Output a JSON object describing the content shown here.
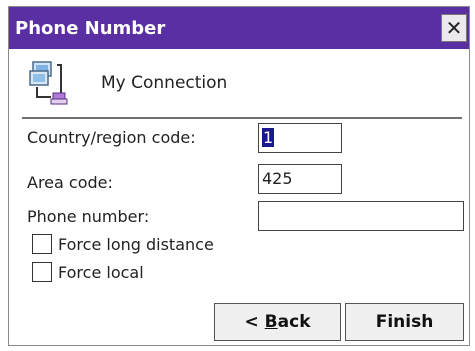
{
  "window": {
    "title": "Phone Number",
    "close_glyph": "✕"
  },
  "connection": {
    "icon": "network-connection-icon",
    "name": "My Connection"
  },
  "form": {
    "country_label": "Country/region code:",
    "country_value": "1",
    "area_label": "Area code:",
    "area_value": "425",
    "phone_label": "Phone number:",
    "phone_value": "",
    "force_long_distance_label": "Force long distance",
    "force_long_distance_checked": false,
    "force_local_label": "Force local",
    "force_local_checked": false
  },
  "buttons": {
    "back_prefix": "< ",
    "back_mnemonic": "B",
    "back_rest": "ack",
    "finish_label": "Finish"
  },
  "colors": {
    "titlebar": "#5a2fa4",
    "selection": "#1a1a8c"
  }
}
